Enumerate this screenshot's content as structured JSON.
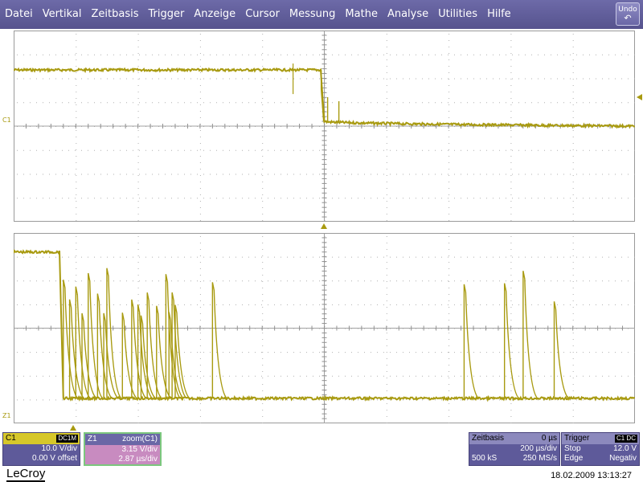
{
  "menu": {
    "items": [
      "Datei",
      "Vertikal",
      "Zeitbasis",
      "Trigger",
      "Anzeige",
      "Cursor",
      "Messung",
      "Mathe",
      "Analyse",
      "Utilities",
      "Hilfe"
    ],
    "undo_label": "Undo",
    "undo_icon": "undo-arrow-icon"
  },
  "colors": {
    "trace": "#a89a10",
    "menu_bg": "#5f5c99",
    "descriptor_bg": "#5e5a9a",
    "channel_yellow": "#d6c72a",
    "zoom_pink": "#c88bc0",
    "zoom_border": "#7cc77e"
  },
  "markers": {
    "c1": "C1",
    "z1": "Z1"
  },
  "c1_descriptor": {
    "label": "C1",
    "coupling": "DC1M",
    "scale": "10.0 V/div",
    "offset": "0.00 V offset"
  },
  "z1_descriptor": {
    "label": "Z1",
    "source": "zoom(C1)",
    "scale": "3.15 V/div",
    "timebase": "2.87 µs/div"
  },
  "timebase_descriptor": {
    "title": "Zeitbasis",
    "delay": "0 µs",
    "per_div": "200 µs/div",
    "samples": "500 kS",
    "rate": "250 MS/s"
  },
  "trigger_descriptor": {
    "title": "Trigger",
    "badge": "C1 DC",
    "mode": "Stop",
    "level": "12.0 V",
    "type": "Edge",
    "slope": "Negativ"
  },
  "footer": {
    "logo": "LeCroy",
    "datetime": "18.02.2009 13:13:27"
  },
  "chart_data": [
    {
      "type": "line",
      "name": "C1",
      "xlim": [
        0,
        10
      ],
      "ylim": [
        -4,
        4
      ],
      "x_divisions": 10,
      "y_divisions": 8,
      "grid": true,
      "segments": [
        {
          "x_start": 0.0,
          "x_end": 4.95,
          "y_div": 2.35
        },
        {
          "x_start": 5.0,
          "x_end": 10.0,
          "y_div_start": 0.2,
          "y_div_end": 0.0
        }
      ]
    },
    {
      "type": "line",
      "name": "Z1",
      "xlim": [
        0,
        10
      ],
      "ylim": [
        -4,
        4
      ],
      "x_divisions": 10,
      "y_divisions": 8,
      "grid": true,
      "segments": [
        {
          "x_start": 0.0,
          "x_end": 0.75,
          "y_div": 3.2
        },
        {
          "x_start": 0.8,
          "x_end": 10.0,
          "y_div": -2.95
        }
      ],
      "spike_x_divs": [
        0.8,
        0.9,
        1.0,
        1.1,
        1.2,
        1.35,
        1.45,
        1.5,
        1.75,
        1.9,
        2.0,
        2.05,
        2.15,
        2.3,
        2.45,
        2.5,
        2.55,
        2.6,
        3.2,
        7.25,
        7.9,
        8.2,
        8.7
      ]
    }
  ]
}
